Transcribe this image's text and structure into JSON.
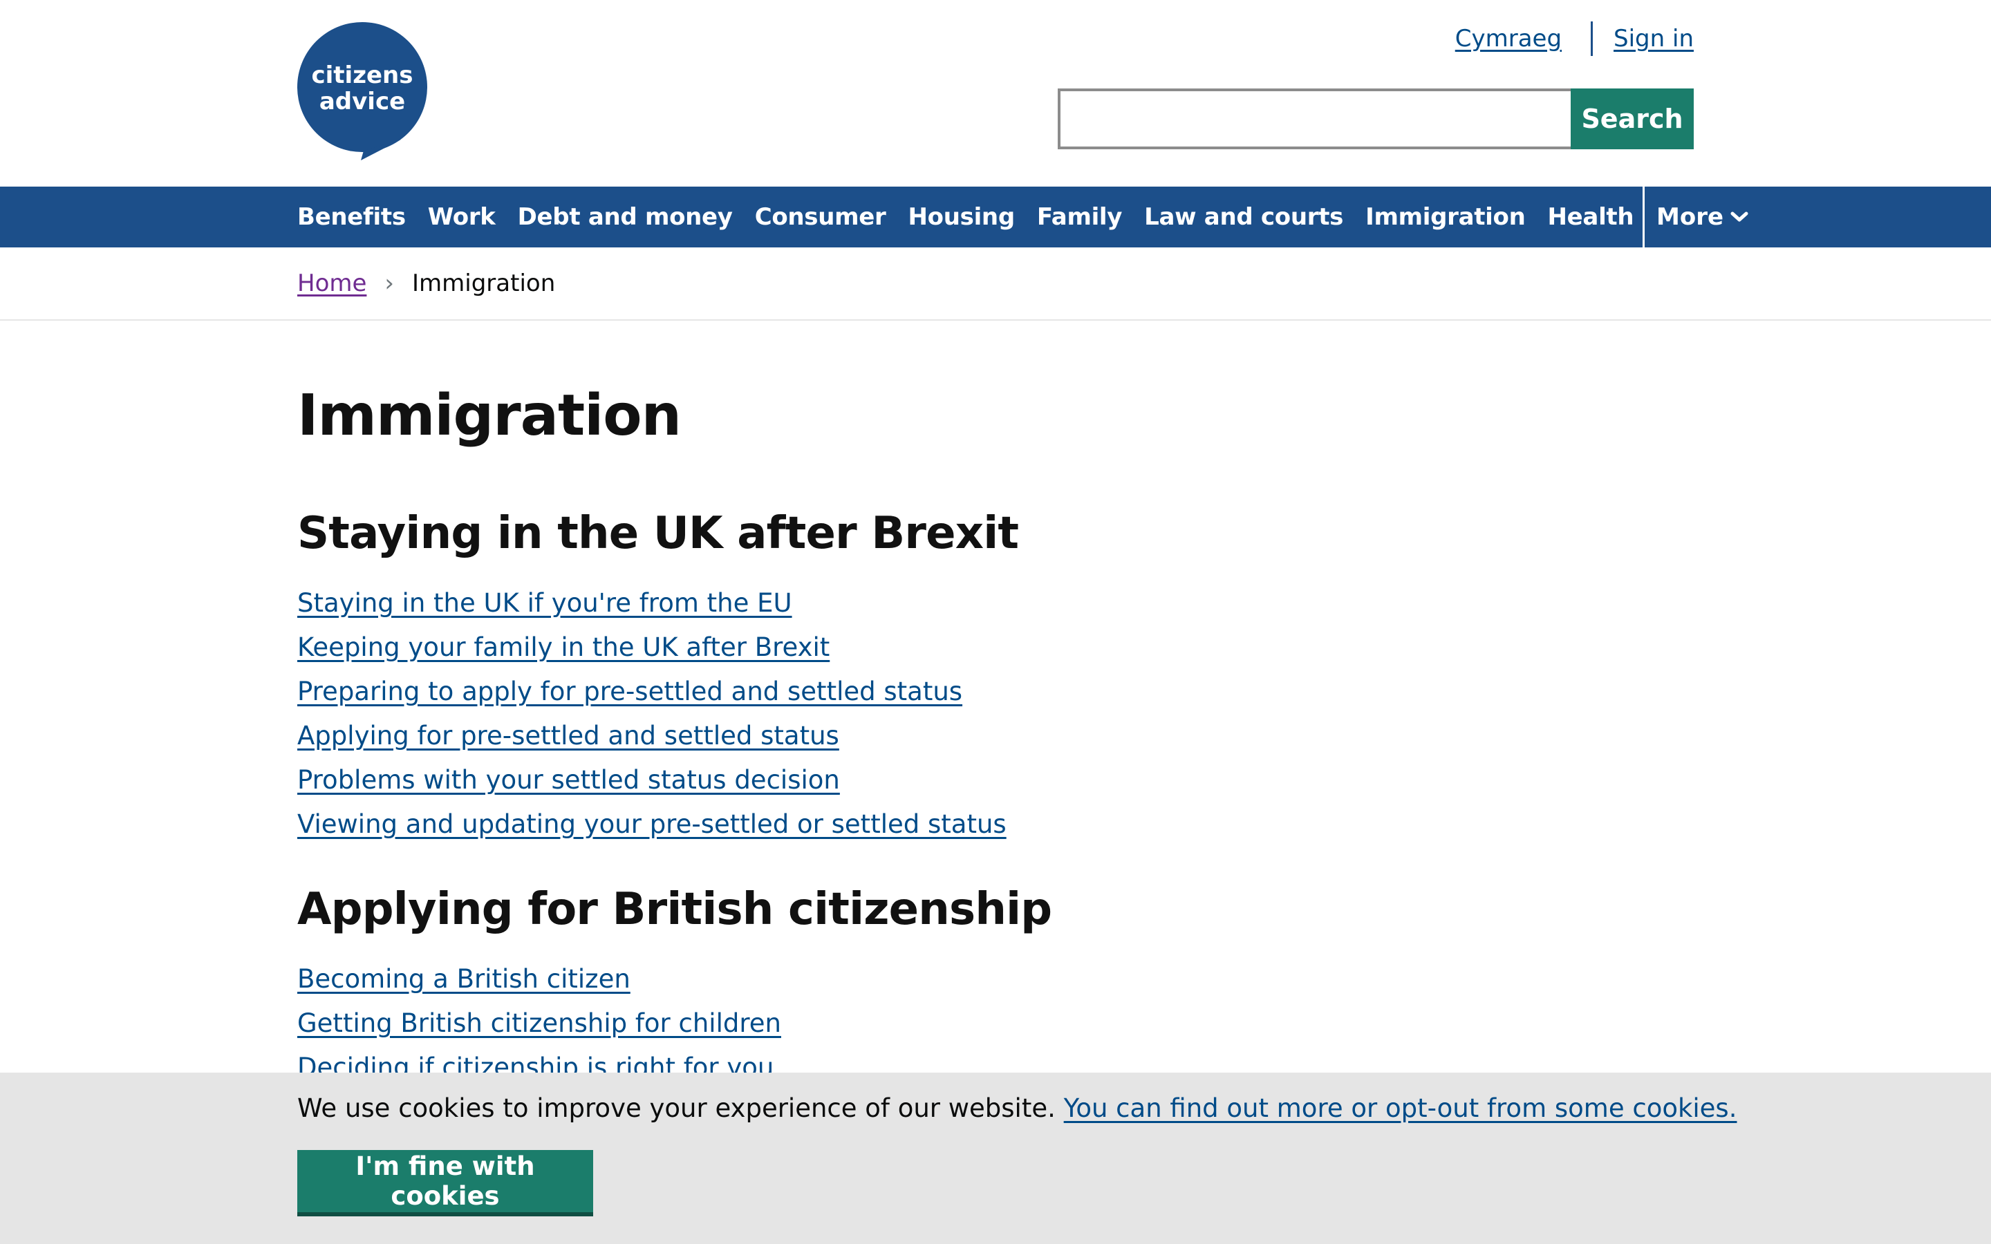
{
  "header": {
    "logo_line1": "citizens",
    "logo_line2": "advice",
    "logo_color": "#1c4f8a",
    "lang_link": "Cymraeg",
    "signin_link": "Sign in",
    "search_placeholder": "",
    "search_button": "Search"
  },
  "nav": {
    "items": [
      "Benefits",
      "Work",
      "Debt and money",
      "Consumer",
      "Housing",
      "Family",
      "Law and courts",
      "Immigration",
      "Health"
    ],
    "more_label": "More"
  },
  "breadcrumb": {
    "home": "Home",
    "current": "Immigration"
  },
  "main": {
    "title": "Immigration",
    "sections": [
      {
        "heading": "Staying in the UK after Brexit",
        "links": [
          "Staying in the UK if you're from the EU",
          "Keeping your family in the UK after Brexit",
          "Preparing to apply for pre-settled and settled status",
          "Applying for pre-settled and settled status",
          "Problems with your settled status decision",
          "Viewing and updating your pre-settled or settled status"
        ]
      },
      {
        "heading": "Applying for British citizenship",
        "links": [
          "Becoming a British citizen",
          "Getting British citizenship for children",
          "Deciding if citizenship is right for you"
        ]
      }
    ]
  },
  "cookie": {
    "text": "We use cookies to improve your experience of our website.",
    "link": "You can find out more or opt-out from some cookies.",
    "button": "I'm fine with cookies"
  },
  "colors": {
    "brand_blue": "#1c4f8a",
    "accent_green": "#1b7d6b",
    "link": "#004b88",
    "visited": "#6f2c91"
  }
}
